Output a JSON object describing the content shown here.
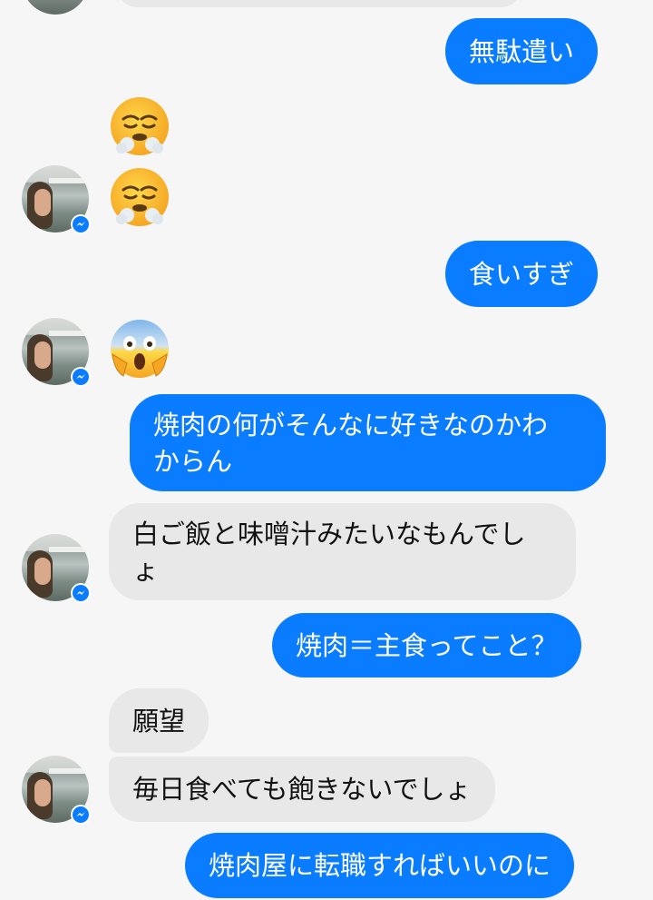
{
  "colors": {
    "outgoing_bubble": "#0a7cff",
    "incoming_bubble": "#e8e8e8",
    "background": "#f6f6f6",
    "messenger_badge": "#0a7cff"
  },
  "messages": [
    {
      "dir": "out",
      "text": "無駄遣い"
    },
    {
      "dir": "in",
      "emoji": "face-with-steam-from-nose"
    },
    {
      "dir": "in",
      "emoji": "face-with-steam-from-nose"
    },
    {
      "dir": "out",
      "text": "食いすぎ"
    },
    {
      "dir": "in",
      "emoji": "face-screaming-in-fear"
    },
    {
      "dir": "out",
      "text": "焼肉の何がそんなに好きなのかわからん"
    },
    {
      "dir": "in",
      "text": "白ご飯と味噌汁みたいなもんでしょ"
    },
    {
      "dir": "out",
      "text": "焼肉＝主食ってこと？"
    },
    {
      "dir": "in",
      "text": "願望"
    },
    {
      "dir": "in",
      "text": "毎日食べても飽きないでしょ"
    },
    {
      "dir": "out",
      "text": "焼肉屋に転職すればいいのに"
    }
  ]
}
